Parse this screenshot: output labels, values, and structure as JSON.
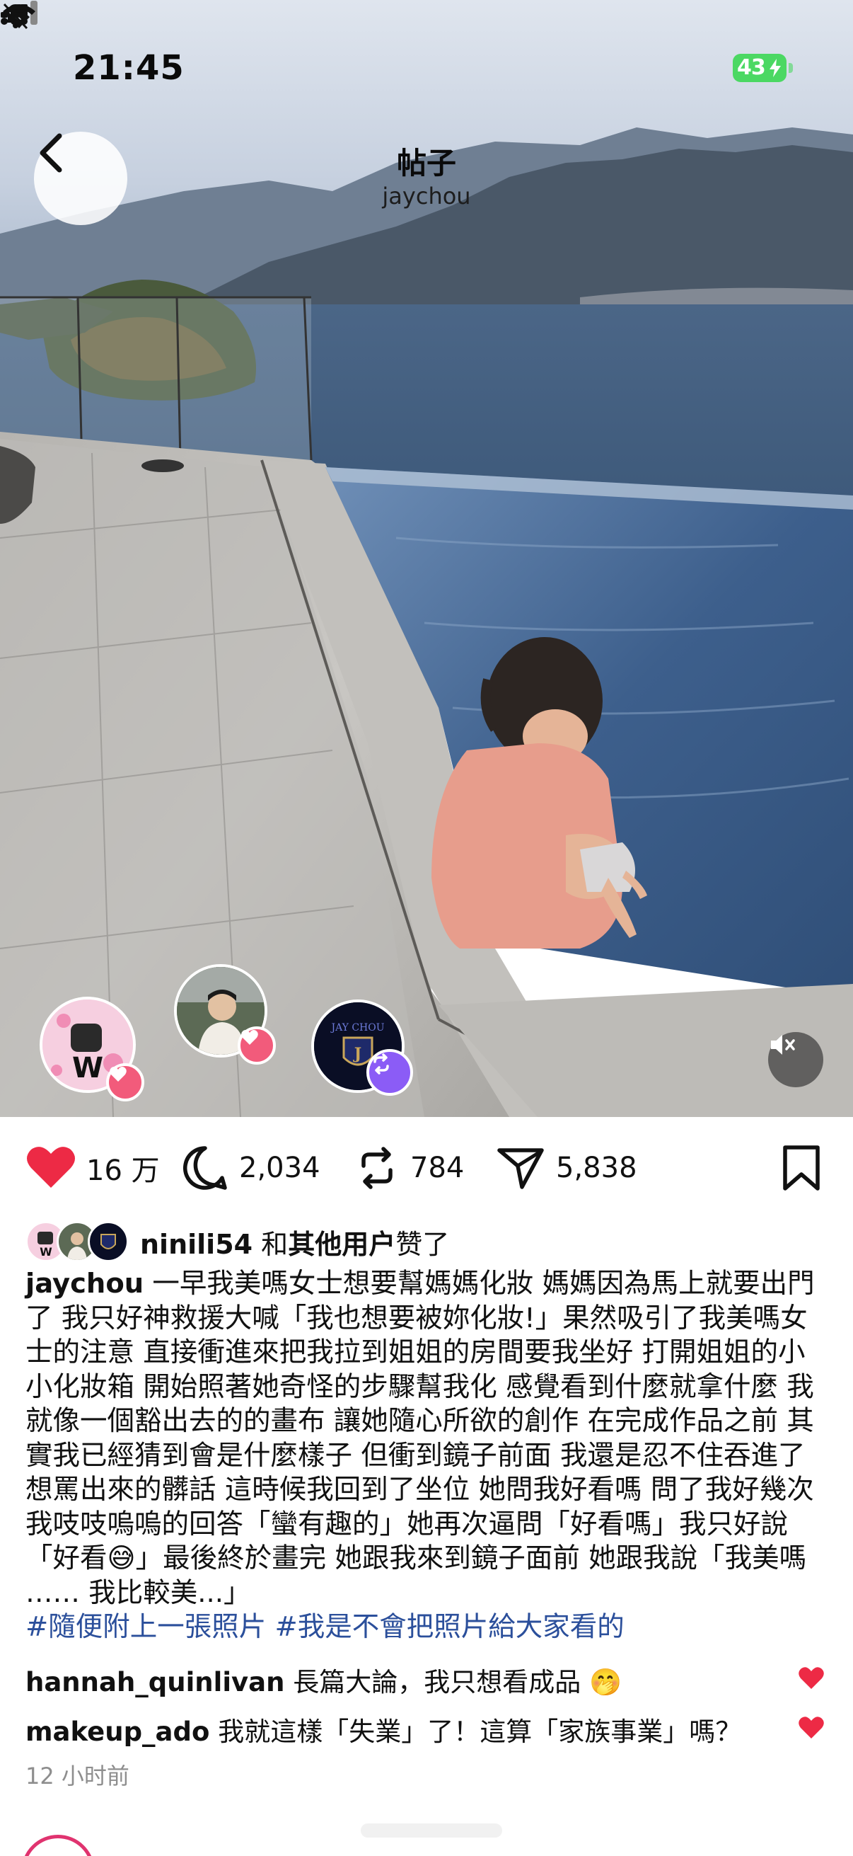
{
  "status_bar": {
    "time": "21:45",
    "battery": "43"
  },
  "nav": {
    "title": "帖子",
    "subtitle": "jaychou"
  },
  "actions": {
    "likes": "16 万",
    "comments": "2,034",
    "reposts": "784",
    "shares": "5,838"
  },
  "liked_by": {
    "user": "ninili54",
    "connector": " 和",
    "others": "其他用户",
    "suffix": "赞了"
  },
  "post": {
    "author": "jaychou",
    "caption": " 一早我美嗎女士想要幫媽媽化妝 媽媽因為馬上就要出門了 我只好神救援大喊「我也想要被妳化妝!」果然吸引了我美嗎女士的注意 直接衝進來把我拉到姐姐的房間要我坐好 打開姐姐的小小化妝箱 開始照著她奇怪的步驟幫我化 感覺看到什麼就拿什麼 我就像一個豁出去的的畫布 讓她隨心所欲的創作 在完成作品之前 其實我已經猜到會是什麼樣子 但衝到鏡子前面 我還是忍不住吞進了想罵出來的髒話 這時候我回到了坐位 她問我好看嗎 問了我好幾次 我吱吱嗚嗚的回答「蠻有趣的」她再次逼問「好看嗎」我只好說「好看😅」最後終於畫完 她跟我來到鏡子面前 她跟我說「我美嗎 …… 我比較美...」",
    "hashtag_1": "#隨便附上一張照片",
    "hashtag_2": "#我是不會把照片給大家看的"
  },
  "comments": [
    {
      "user": "hannah_quinlivan",
      "text": " 長篇大論，我只想看成品 🤭"
    },
    {
      "user": "makeup_ado",
      "text": " 我就這樣「失業」了！這算「家族事業」嗎？"
    }
  ],
  "timestamp": "12 小时前",
  "colors": {
    "like_red": "#ed2a45",
    "hashtag_blue": "#2b4f9b",
    "battery_green": "#4bd863"
  },
  "icons": [
    "back-chevron-icon",
    "bell-muted-icon",
    "signal-icon",
    "wifi-icon",
    "heart-icon",
    "comment-icon",
    "repost-icon",
    "share-icon",
    "bookmark-icon",
    "mute-icon"
  ]
}
